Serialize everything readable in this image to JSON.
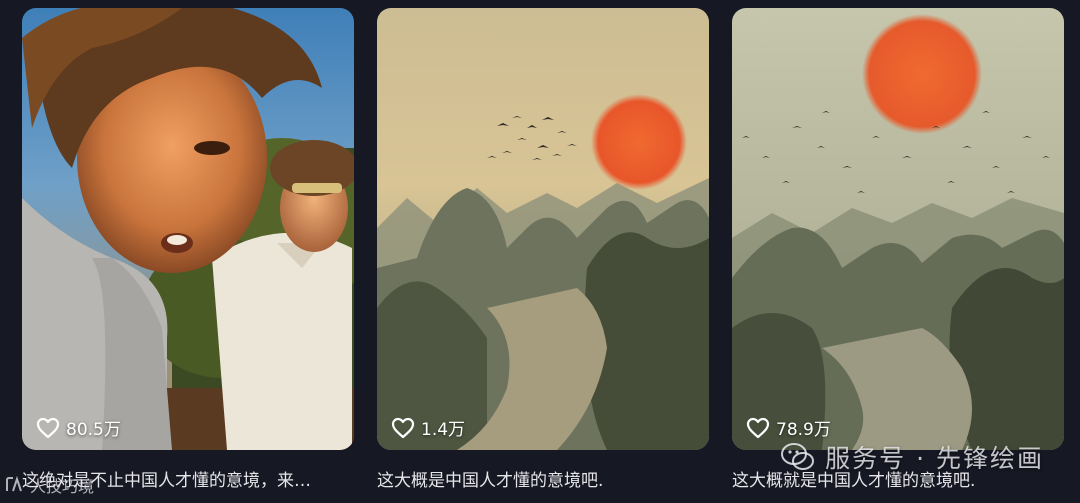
{
  "cards": [
    {
      "likes": "80.5万",
      "caption": "这绝对是不止中国人才懂的意境，来…"
    },
    {
      "likes": "1.4万",
      "caption": "这大概是中国人才懂的意境吧."
    },
    {
      "likes": "78.9万",
      "caption": "这大概就是中国人才懂的意境吧."
    }
  ],
  "watermark": {
    "text": "服务号 · 先锋绘画",
    "icon": "wechat-icon"
  },
  "watermark_left": {
    "text": "人技巧境",
    "icon": "logo-icon"
  },
  "icons": {
    "like": "heart-outline-icon"
  },
  "colors": {
    "background": "#161823",
    "sun": "#e8562a",
    "caption": "#e6e6ea"
  }
}
